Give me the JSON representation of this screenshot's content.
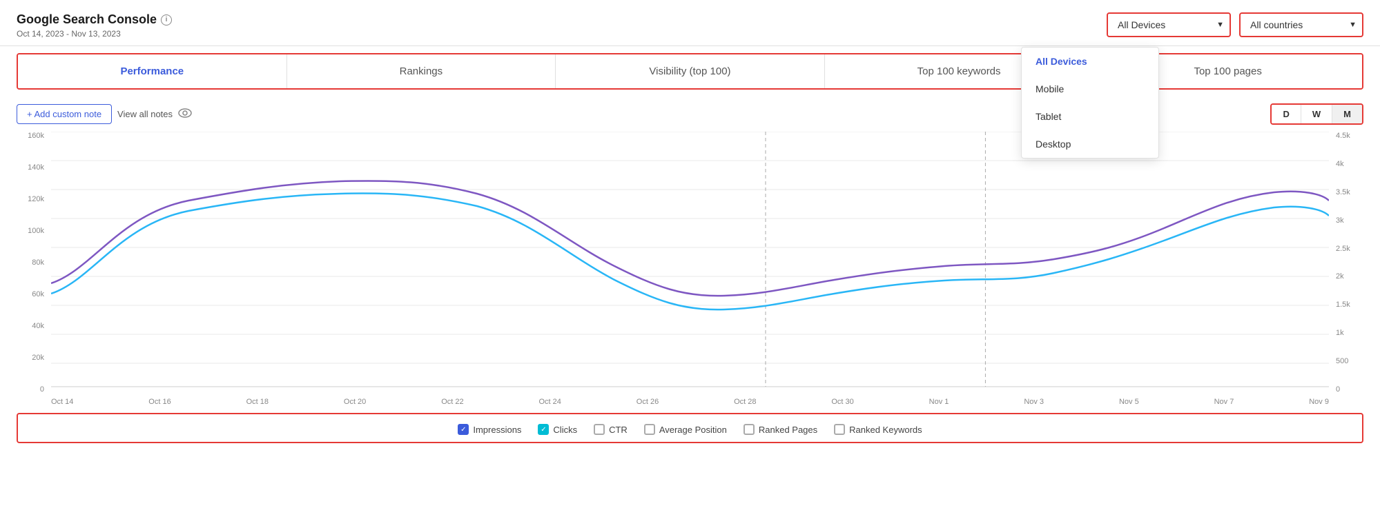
{
  "header": {
    "title": "Google Search Console",
    "dateRange": "Oct 14, 2023 - Nov 13, 2023"
  },
  "deviceDropdown": {
    "label": "All Devices",
    "options": [
      "All Devices",
      "Mobile",
      "Tablet",
      "Desktop"
    ],
    "selected": "All Devices"
  },
  "countryDropdown": {
    "label": "All countries",
    "options": [
      "All countries"
    ],
    "selected": "All countries"
  },
  "tabs": [
    {
      "label": "Performance",
      "active": true
    },
    {
      "label": "Rankings",
      "active": false
    },
    {
      "label": "Visibility (top 100)",
      "active": false
    },
    {
      "label": "Top 100 keywords",
      "active": false
    },
    {
      "label": "Top 100 pages",
      "active": false
    }
  ],
  "toolbar": {
    "addNote": "+ Add custom note",
    "viewNotes": "View all notes",
    "timeButtons": [
      "D",
      "W",
      "M"
    ],
    "activeTime": "M"
  },
  "yAxisLeft": [
    "160k",
    "140k",
    "120k",
    "100k",
    "80k",
    "60k",
    "40k",
    "20k",
    "0"
  ],
  "yAxisRight": [
    "4.5k",
    "4k",
    "3.5k",
    "3k",
    "2.5k",
    "2k",
    "1.5k",
    "1k",
    "500",
    "0"
  ],
  "xAxisLabels": [
    "Oct 14",
    "Oct 16",
    "Oct 18",
    "Oct 20",
    "Oct 22",
    "Oct 24",
    "Oct 26",
    "Oct 28",
    "Oct 30",
    "Nov 1",
    "Nov 3",
    "Nov 5",
    "Nov 7",
    "Nov 9"
  ],
  "legend": [
    {
      "label": "Impressions",
      "checked": true,
      "color": "blue"
    },
    {
      "label": "Clicks",
      "checked": true,
      "color": "cyan"
    },
    {
      "label": "CTR",
      "checked": false
    },
    {
      "label": "Average Position",
      "checked": false
    },
    {
      "label": "Ranked Pages",
      "checked": false
    },
    {
      "label": "Ranked Keywords",
      "checked": false
    }
  ],
  "dropdownMenu": {
    "options": [
      {
        "label": "All Devices",
        "selected": true
      },
      {
        "label": "Mobile",
        "selected": false
      },
      {
        "label": "Tablet",
        "selected": false
      },
      {
        "label": "Desktop",
        "selected": false
      }
    ]
  },
  "colors": {
    "accent": "#e53935",
    "blue": "#3b5bdb",
    "cyan": "#29b6f6",
    "purple": "#7e57c2"
  }
}
